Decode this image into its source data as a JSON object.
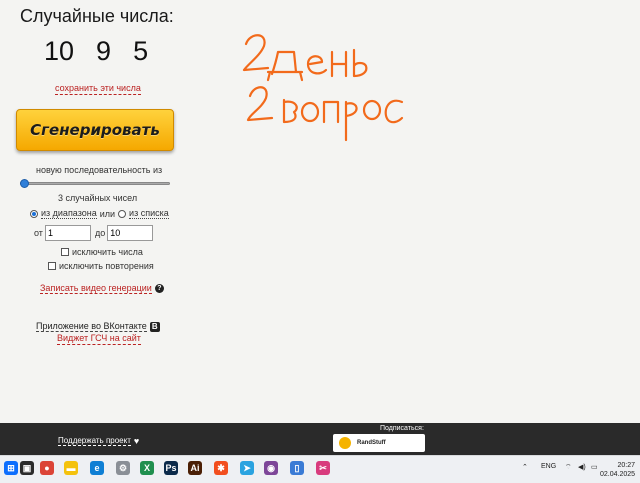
{
  "header": {
    "title": "Случайные числа:"
  },
  "result": {
    "numbers": [
      "10",
      "9",
      "5"
    ],
    "save_label": "сохранить эти числа"
  },
  "generate_button": {
    "label": "Сгенерировать"
  },
  "sequence": {
    "label": "новую последовательность из",
    "slider_fraction": 0.0
  },
  "count_label": "3 случайных чисел",
  "mode": {
    "range_label": "из диапазона",
    "or_label": "или",
    "list_label": "из списка",
    "selected": "range"
  },
  "range": {
    "from_label": "от",
    "from_value": "1",
    "to_label": "до",
    "to_value": "10"
  },
  "options": {
    "exclude_numbers": "исключить числа",
    "exclude_repeats": "исключить повторения"
  },
  "record_link": "Записать видео генерации",
  "vk_link": "Приложение во ВКонтакте",
  "widget_link": "Виджет ГСЧ на сайт",
  "handwriting": {
    "line1": "2 день",
    "line2": "2 вопрос",
    "color": "#f26a1b"
  },
  "footer": {
    "support_label": "Поддержать проект",
    "subscribe_label": "Подписаться:",
    "channel_name": "RandStuff"
  },
  "taskbar": {
    "icons": [
      "start-icon",
      "task-view-icon",
      "chrome-icon",
      "file-explorer-icon",
      "edge-icon",
      "settings-icon",
      "excel-icon",
      "photoshop-icon",
      "illustrator-icon",
      "figma-icon",
      "telegram-icon",
      "tor-icon",
      "phone-link-icon",
      "snipping-tool-icon"
    ],
    "language": "ENG",
    "time": "20:27",
    "date": "02.04.2025"
  }
}
